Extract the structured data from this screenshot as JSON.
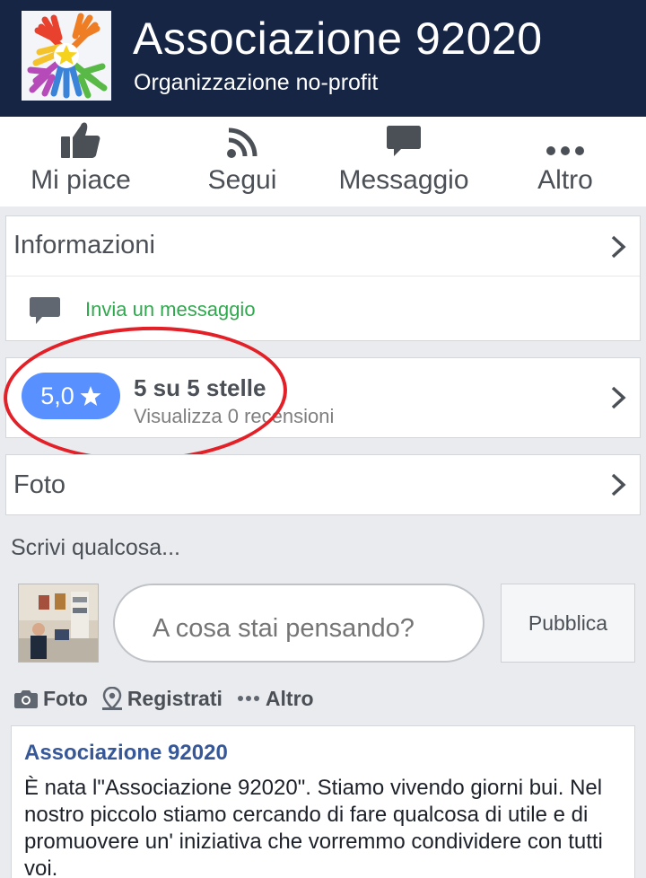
{
  "header": {
    "page_name": "Associazione 92020",
    "category": "Organizzazione no-profit",
    "logo_icon": "colorful-hands-star-logo"
  },
  "actions": [
    {
      "label": "Mi piace",
      "icon": "thumbs-up-icon"
    },
    {
      "label": "Segui",
      "icon": "rss-icon"
    },
    {
      "label": "Messaggio",
      "icon": "chat-bubble-icon"
    },
    {
      "label": "Altro",
      "icon": "more-dots-icon"
    }
  ],
  "info": {
    "title": "Informazioni",
    "send_message": "Invia un messaggio"
  },
  "rating": {
    "score": "5,0",
    "title": "5 su 5 stelle",
    "subtitle": "Visualizza 0 recensioni"
  },
  "photos": {
    "title": "Foto"
  },
  "composer": {
    "title": "Scrivi qualcosa...",
    "placeholder": "A cosa stai pensando?",
    "publish": "Pubblica",
    "options": {
      "photo": "Foto",
      "checkin": "Registrati",
      "more": "Altro"
    }
  },
  "post": {
    "author": "Associazione 92020",
    "text": "È nata l\"Associazione 92020\". Stiamo vivendo giorni bui. Nel nostro piccolo stiamo cercando di fare qualcosa di utile e di promuovere un' iniziativa che vorremmo condividere con tutti voi."
  },
  "colors": {
    "header_bg": "#172544",
    "accent_blue": "#5890ff",
    "link_green": "#2fa94e",
    "author_blue": "#365899",
    "annotation_red": "#e32027"
  }
}
